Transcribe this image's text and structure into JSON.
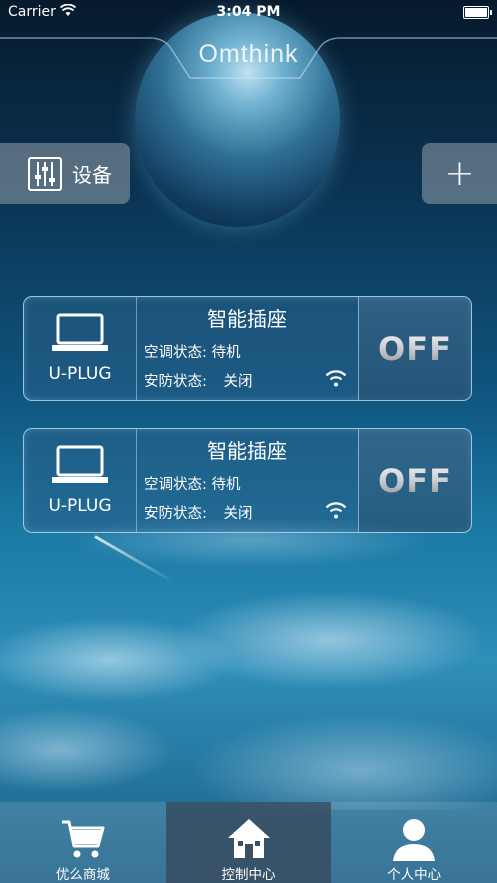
{
  "status_bar": {
    "carrier": "Carrier",
    "time": "3:04 PM"
  },
  "header": {
    "brand": "Omthink"
  },
  "toolbar": {
    "devices_label": "设备",
    "add_label": "+"
  },
  "devices": [
    {
      "type_label": "U-PLUG",
      "title": "智能插座",
      "ac_status_label": "空调状态:",
      "ac_status_value": "待机",
      "security_label": "安防状态:",
      "security_value": "关闭",
      "power_label": "OFF"
    },
    {
      "type_label": "U-PLUG",
      "title": "智能插座",
      "ac_status_label": "空调状态:",
      "ac_status_value": "待机",
      "security_label": "安防状态:",
      "security_value": "关闭",
      "power_label": "OFF"
    }
  ],
  "tabbar": {
    "tabs": [
      {
        "label": "优么商城",
        "icon": "cart-icon"
      },
      {
        "label": "控制中心",
        "icon": "home-icon",
        "active": true
      },
      {
        "label": "个人中心",
        "icon": "person-icon"
      }
    ]
  }
}
